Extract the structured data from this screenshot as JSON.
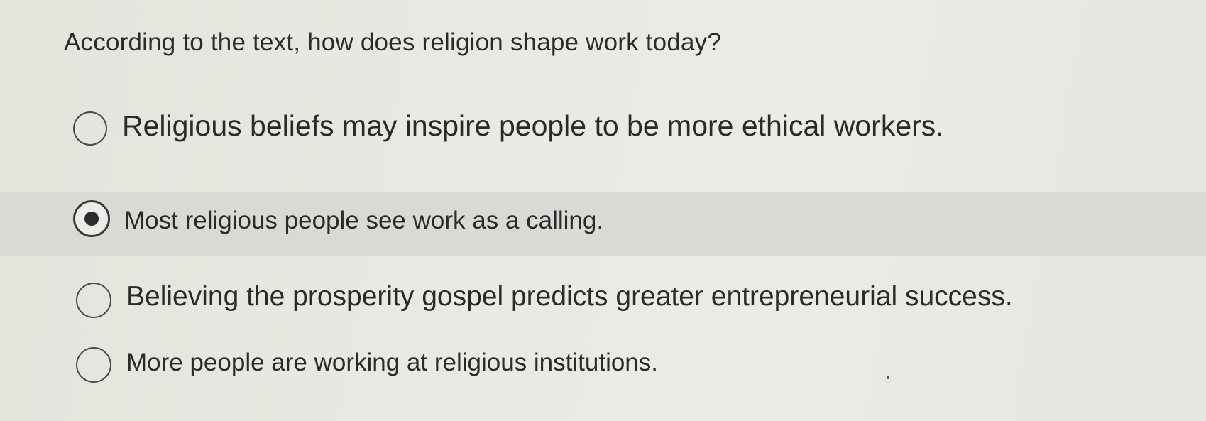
{
  "question": {
    "text": "According to the text, how does religion shape work today?"
  },
  "options": [
    {
      "label": "Religious beliefs may inspire people to be more ethical workers.",
      "selected": false
    },
    {
      "label": "Most religious people see work as a calling.",
      "selected": true
    },
    {
      "label": "Believing the prosperity gospel predicts greater entrepreneurial success.",
      "selected": false
    },
    {
      "label": "More people are working at religious institutions.",
      "selected": false
    }
  ],
  "colors": {
    "background": "#e9e8e2",
    "selected_row": "#d9dad6",
    "text": "#2a2a2a"
  }
}
